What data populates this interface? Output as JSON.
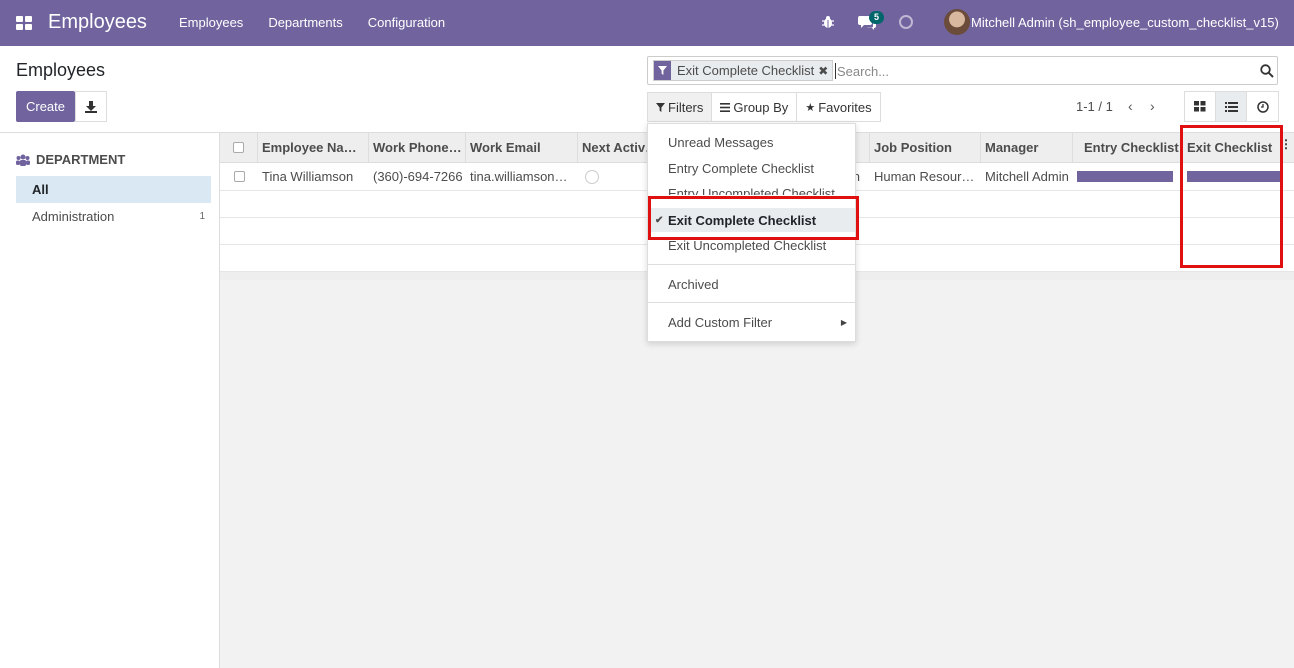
{
  "navbar": {
    "brand": "Employees",
    "menu": [
      "Employees",
      "Departments",
      "Configuration"
    ],
    "chat_count": "5",
    "user": "Mitchell Admin (sh_employee_custom_checklist_v15)"
  },
  "control": {
    "breadcrumb": "Employees",
    "create_label": "Create",
    "facet_label": "Exit Complete Checklist",
    "search_placeholder": "Search...",
    "filters_label": "Filters",
    "groupby_label": "Group By",
    "favorites_label": "Favorites",
    "pager": "1-1 / 1"
  },
  "sidebar": {
    "header": "DEPARTMENT",
    "items": [
      {
        "label": "All",
        "count": ""
      },
      {
        "label": "Administration",
        "count": "1"
      }
    ]
  },
  "table": {
    "columns": [
      "Employee Na…",
      "Work Phone…",
      "Work Email",
      "Next Activ…",
      "",
      "Job Position",
      "Manager",
      "Entry Checklist",
      "Exit Checklist"
    ],
    "rows": [
      {
        "name": "Tina Williamson",
        "phone": "(360)-694-7266",
        "email": "tina.williamson…",
        "partial": "n",
        "job": "Human Resour…",
        "manager": "Mitchell Admin",
        "entry_progress": 1,
        "exit_progress": 1
      }
    ]
  },
  "filters_dropdown": {
    "items": [
      "Unread Messages",
      "Entry Complete Checklist",
      "Entry Uncompleted Checklist",
      "Exit Complete Checklist",
      "Exit Uncompleted Checklist",
      "Archived",
      "Add Custom Filter"
    ],
    "selected": "Exit Complete Checklist"
  },
  "colors": {
    "brand": "#71639e",
    "highlight": "#e01010"
  }
}
